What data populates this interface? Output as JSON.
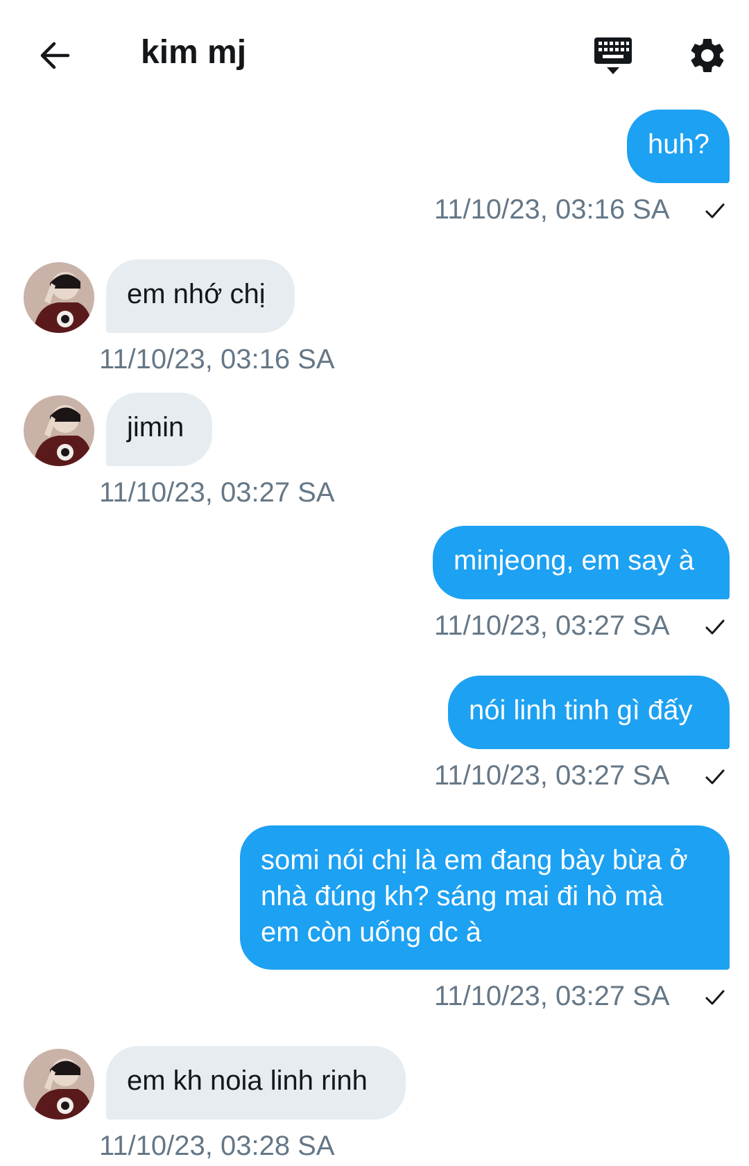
{
  "header": {
    "title": "kim mj",
    "back_icon": "arrow-left-icon",
    "keyboard_icon": "keyboard-icon",
    "settings_icon": "gear-icon"
  },
  "colors": {
    "outgoing_bubble": "#1da1f2",
    "incoming_bubble": "#e6ecf0",
    "timestamp": "#657786",
    "text_dark": "#14171a"
  },
  "messages": [
    {
      "direction": "out",
      "text": "huh?",
      "time": "11/10/23, 03:16 SA",
      "read_icon": "checkmark-icon"
    },
    {
      "direction": "in",
      "text": "em nhớ chị",
      "time": "11/10/23, 03:16 SA",
      "avatar": "avatar"
    },
    {
      "direction": "in",
      "text": "jimin",
      "time": "11/10/23, 03:27 SA",
      "avatar": "avatar"
    },
    {
      "direction": "out",
      "text": "minjeong, em say à",
      "time": "11/10/23, 03:27 SA",
      "read_icon": "checkmark-icon"
    },
    {
      "direction": "out",
      "text": "nói linh tinh gì đấy",
      "time": "11/10/23, 03:27 SA",
      "read_icon": "checkmark-icon"
    },
    {
      "direction": "out",
      "text": "somi nói chị là em đang bày bừa ở nhà đúng kh? sáng mai đi hò mà em còn uống dc à",
      "time": "11/10/23, 03:27 SA",
      "read_icon": "checkmark-icon"
    },
    {
      "direction": "in",
      "text": "em kh noia linh rinh",
      "time": "11/10/23, 03:28 SA",
      "avatar": "avatar"
    }
  ]
}
